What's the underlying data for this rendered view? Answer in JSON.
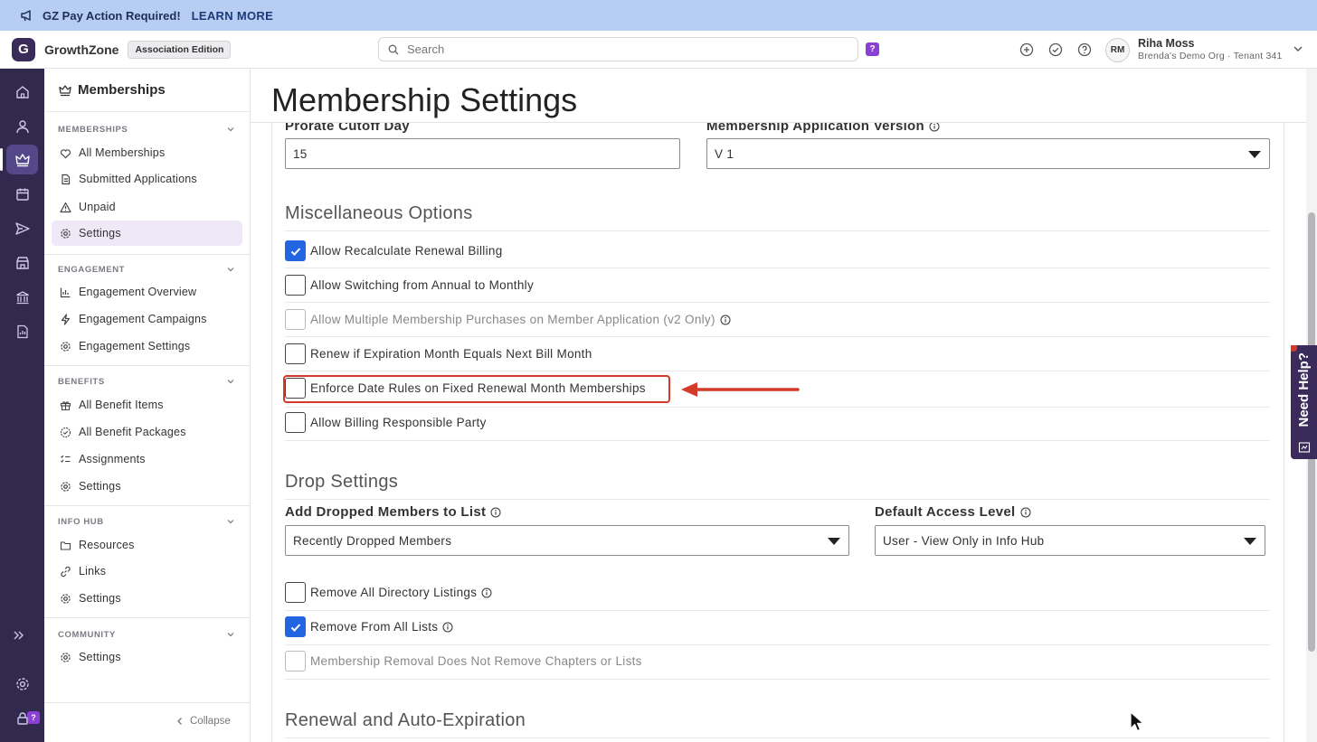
{
  "banner": {
    "text": "GZ Pay Action Required!",
    "link": "LEARN MORE"
  },
  "header": {
    "logo_letter": "G",
    "brand": "GrowthZone",
    "edition": "Association Edition",
    "search_placeholder": "Search",
    "help_badge": "?",
    "user_initials": "RM",
    "user_name": "Riha Moss",
    "user_org": "Brenda's Demo Org · Tenant 341"
  },
  "rail": {
    "help_badge": "?"
  },
  "sidebar": {
    "title": "Memberships",
    "sections": [
      {
        "heading": "MEMBERSHIPS",
        "items": [
          "All Memberships",
          "Submitted Applications",
          "Unpaid",
          "Settings"
        ]
      },
      {
        "heading": "ENGAGEMENT",
        "items": [
          "Engagement Overview",
          "Engagement Campaigns",
          "Engagement Settings"
        ]
      },
      {
        "heading": "BENEFITS",
        "items": [
          "All Benefit Items",
          "All Benefit Packages",
          "Assignments",
          "Settings"
        ]
      },
      {
        "heading": "INFO HUB",
        "items": [
          "Resources",
          "Links",
          "Settings"
        ]
      },
      {
        "heading": "COMMUNITY",
        "items": [
          "Settings"
        ]
      }
    ],
    "collapse": "Collapse"
  },
  "page": {
    "title": "Membership Settings",
    "prorate_label": "Prorate Cutoff Day",
    "prorate_value": "15",
    "app_version_label": "Membership Application Version",
    "app_version_value": "V 1",
    "misc_title": "Miscellaneous Options",
    "misc_options": [
      {
        "label": "Allow Recalculate Renewal Billing",
        "checked": true
      },
      {
        "label": "Allow Switching from Annual to Monthly",
        "checked": false
      },
      {
        "label": "Allow Multiple Membership Purchases on Member Application (v2 Only)",
        "checked": false,
        "disabled": true
      },
      {
        "label": "Renew if Expiration Month Equals Next Bill Month",
        "checked": false
      },
      {
        "label": "Enforce Date Rules on Fixed Renewal Month Memberships",
        "checked": false
      },
      {
        "label": "Allow Billing Responsible Party",
        "checked": false
      }
    ],
    "drop_title": "Drop Settings",
    "dropped_list_label": "Add Dropped Members to List",
    "dropped_list_value": "Recently Dropped Members",
    "access_label": "Default Access Level",
    "access_value": "User - View Only in Info Hub",
    "drop_options": [
      {
        "label": "Remove All Directory Listings",
        "checked": false
      },
      {
        "label": "Remove From All Lists",
        "checked": true
      },
      {
        "label": "Membership Removal Does Not Remove Chapters or Lists",
        "checked": false,
        "disabled": true
      }
    ],
    "renewal_title": "Renewal and Auto-Expiration"
  },
  "need_help": "Need Help?",
  "colors": {
    "brand": "#3a2b5b",
    "accent": "#2166e0",
    "highlight": "#d43a2a",
    "banner": "#b8cdf2"
  }
}
